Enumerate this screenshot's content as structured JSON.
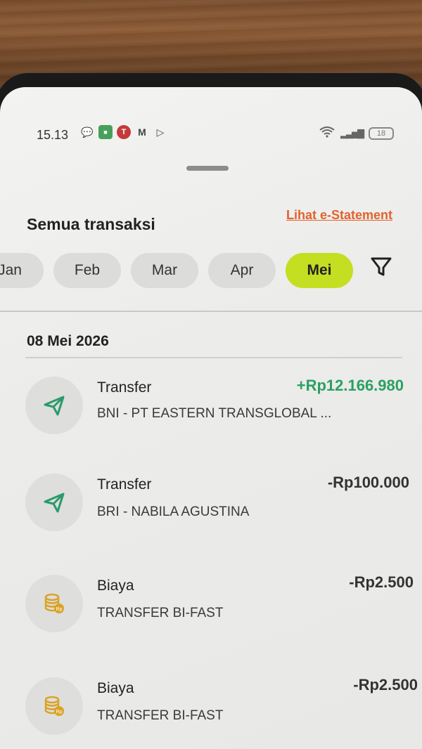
{
  "status": {
    "time": "15.13",
    "battery": "18"
  },
  "header": {
    "title": "Semua transaksi",
    "estatement_link": "Lihat e-Statement"
  },
  "months": [
    "Jan",
    "Feb",
    "Mar",
    "Apr",
    "Mei"
  ],
  "selected_month": "Mei",
  "date_group": "08 Mei 2026",
  "transactions": [
    {
      "type": "Transfer",
      "desc": "BNI - PT EASTERN TRANSGLOBAL ...",
      "amount": "+Rp12.166.980",
      "icon": "paper-plane-icon"
    },
    {
      "type": "Transfer",
      "desc": "BRI - NABILA AGUSTINA",
      "amount": "-Rp100.000",
      "icon": "paper-plane-icon"
    },
    {
      "type": "Biaya",
      "desc": "TRANSFER BI-FAST",
      "amount": "-Rp2.500",
      "icon": "coin-stack-icon"
    },
    {
      "type": "Biaya",
      "desc": "TRANSFER BI-FAST",
      "amount": "-Rp2.500",
      "icon": "coin-stack-icon"
    }
  ],
  "colors": {
    "accent_orange": "#e2622d",
    "active_month": "#c4de22",
    "positive": "#2aa063",
    "icon_green": "#2a9a6a",
    "icon_gold": "#d9a326"
  }
}
